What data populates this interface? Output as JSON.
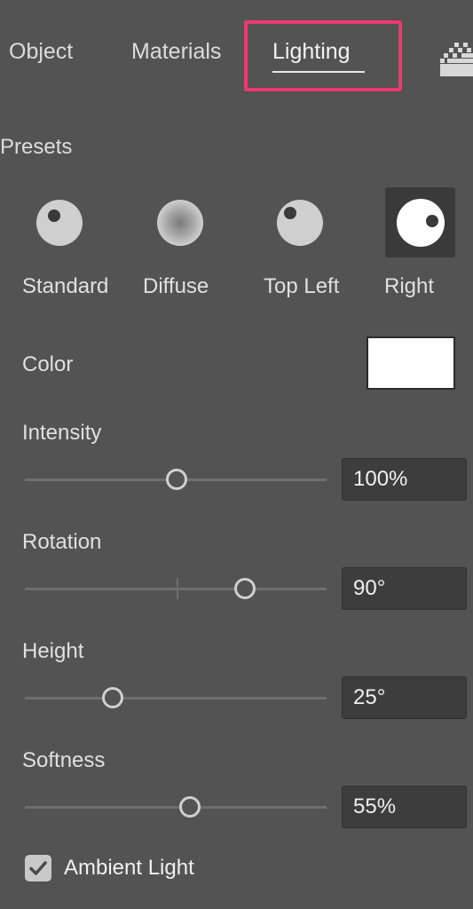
{
  "tabs": [
    {
      "label": "Object"
    },
    {
      "label": "Materials"
    },
    {
      "label": "Lighting",
      "active": true
    }
  ],
  "overflow_icon": "checker-grid-icon",
  "highlight_color": "#ec3a6b",
  "presets": {
    "label": "Presets",
    "items": [
      {
        "label": "Standard",
        "icon": "standard-light-icon"
      },
      {
        "label": "Diffuse",
        "icon": "diffuse-light-icon"
      },
      {
        "label": "Top Left",
        "icon": "top-left-light-icon"
      },
      {
        "label": "Right",
        "icon": "right-light-icon",
        "selected": true
      }
    ]
  },
  "color": {
    "label": "Color",
    "value": "#ffffff"
  },
  "intensity": {
    "label": "Intensity",
    "value": "100%",
    "slider_fraction": 0.5
  },
  "rotation": {
    "label": "Rotation",
    "value": "90°",
    "slider_fraction": 0.73
  },
  "height": {
    "label": "Height",
    "value": "25°",
    "slider_fraction": 0.29
  },
  "softness": {
    "label": "Softness",
    "value": "55%",
    "slider_fraction": 0.55
  },
  "ambient_light": {
    "label": "Ambient Light",
    "checked": true
  }
}
